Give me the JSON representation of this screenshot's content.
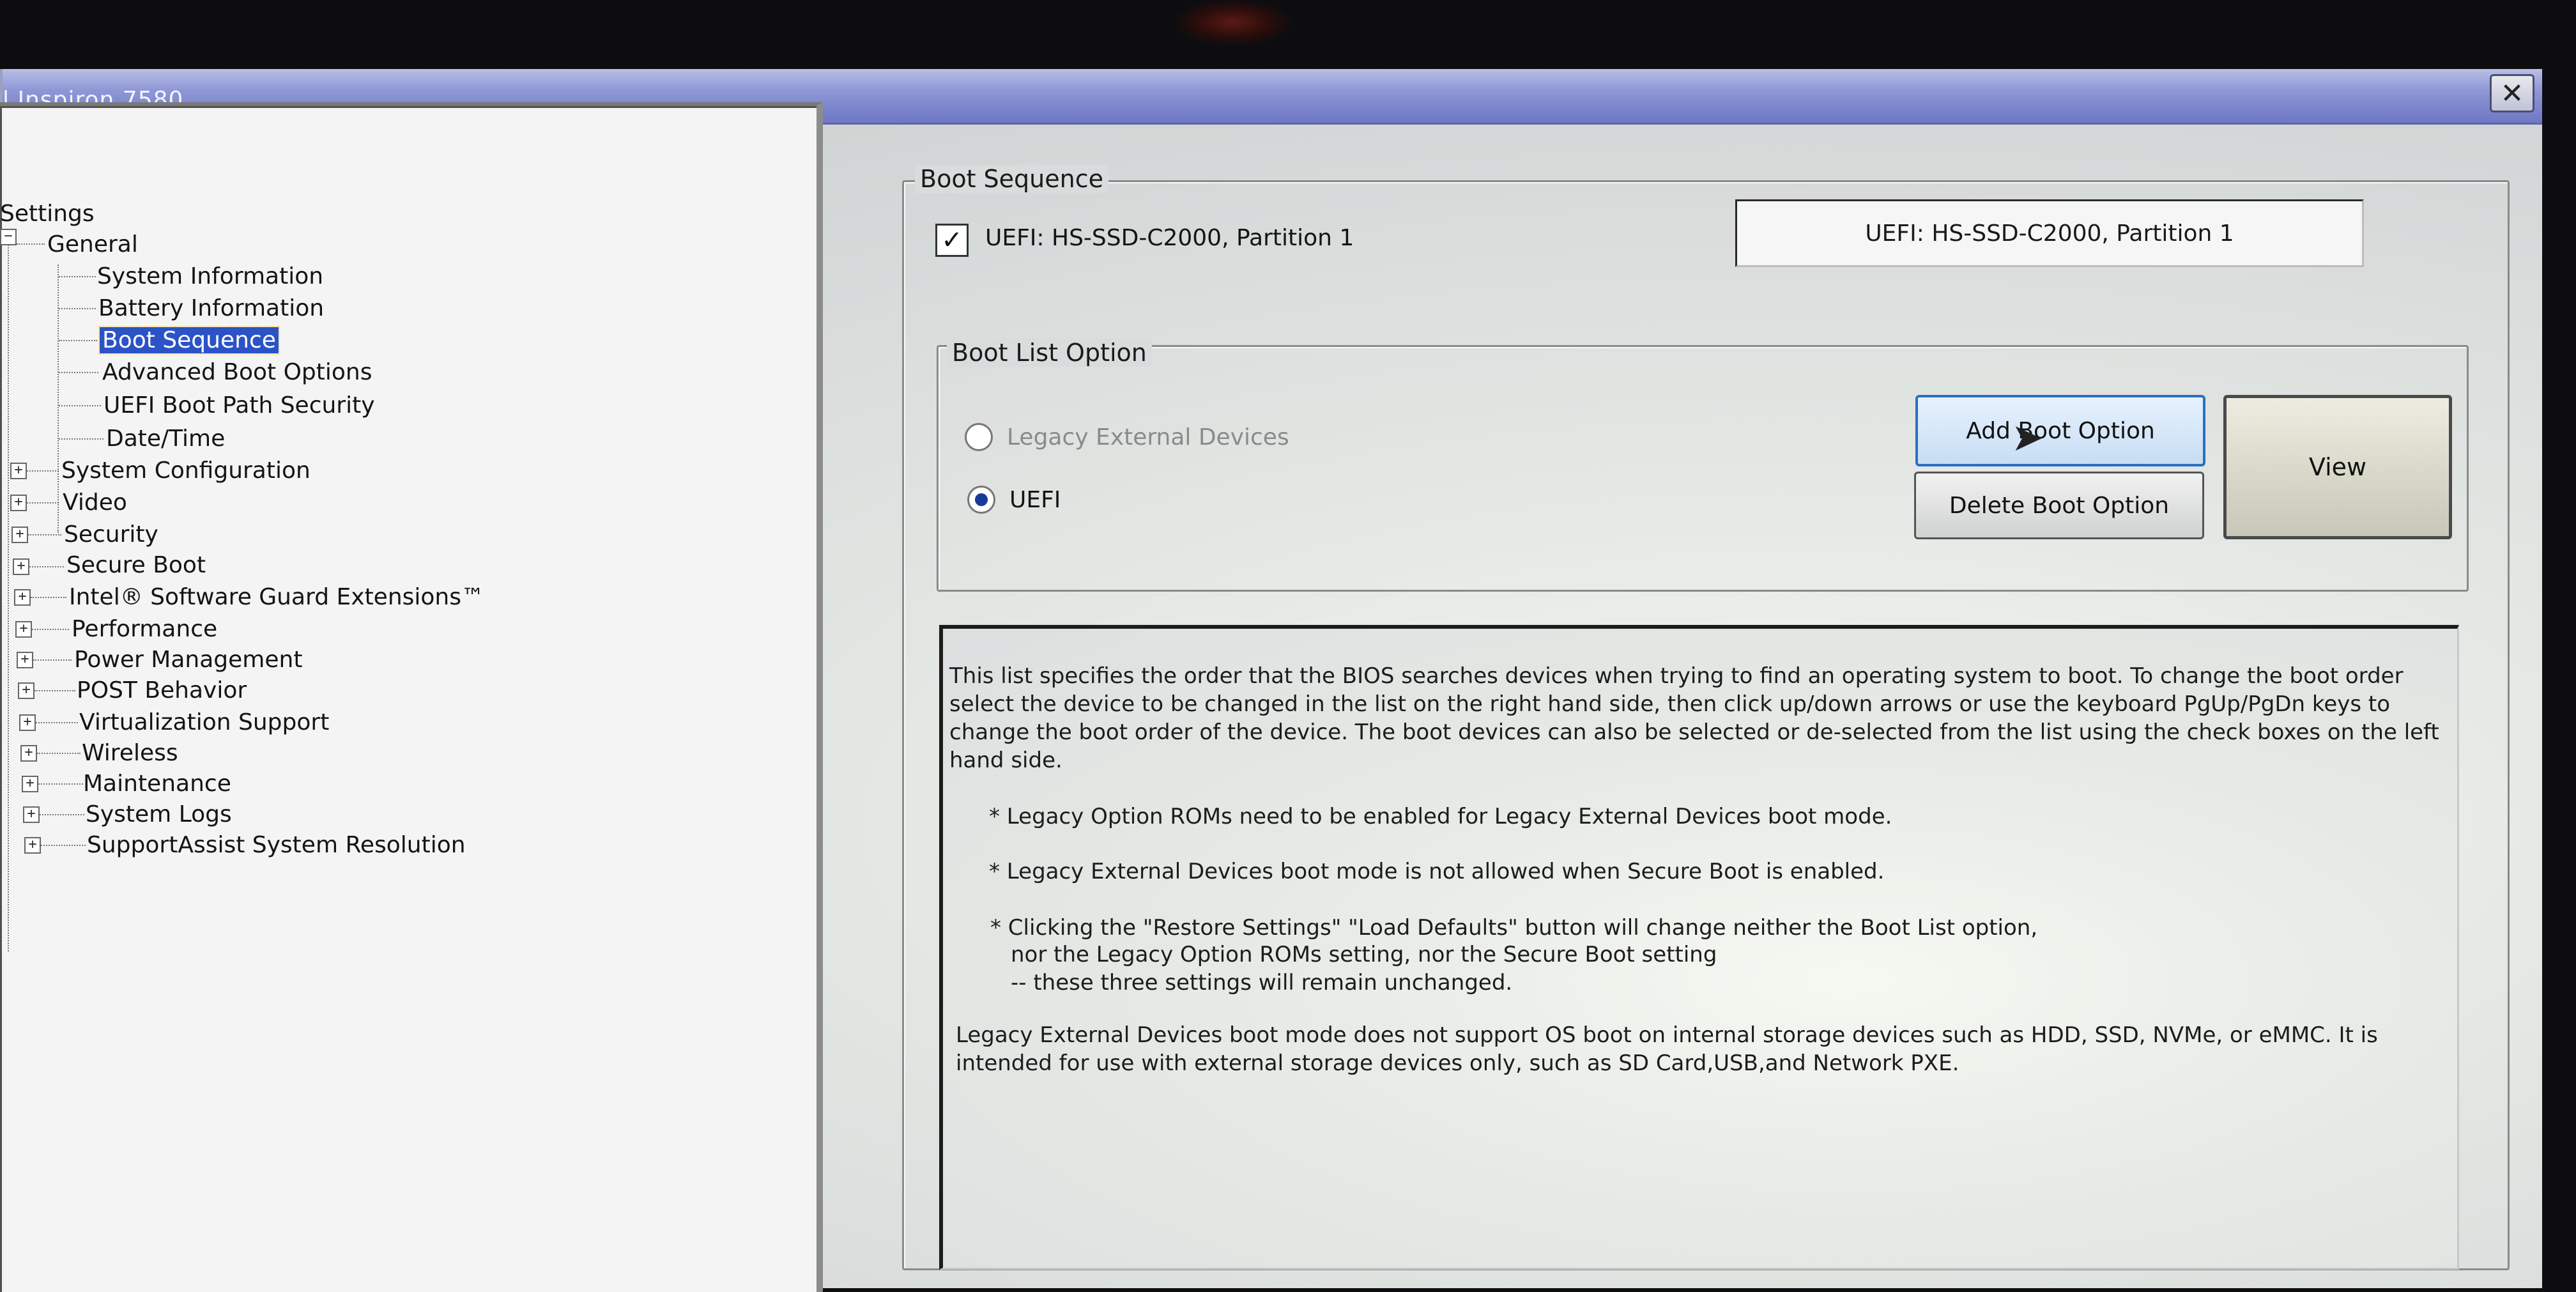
{
  "window": {
    "title": "l Inspiron 7580",
    "close_icon": "close-icon"
  },
  "tree": {
    "root": "Settings",
    "general": "General",
    "general_children": [
      "System Information",
      "Battery Information",
      "Boot Sequence",
      "Advanced Boot Options",
      "UEFI Boot Path Security",
      "Date/Time"
    ],
    "selected": "Boot Sequence",
    "groups": [
      "System Configuration",
      "Video",
      "Security",
      "Secure Boot",
      "Intel® Software Guard Extensions™",
      "Performance",
      "Power Management",
      "POST Behavior",
      "Virtualization Support",
      "Wireless",
      "Maintenance",
      "System Logs",
      "SupportAssist System Resolution"
    ]
  },
  "boot_sequence": {
    "legend": "Boot Sequence",
    "entry_label": "UEFI: HS-SSD-C2000, Partition 1",
    "entry_checked": true,
    "list_item": "UEFI: HS-SSD-C2000, Partition 1"
  },
  "boot_list_option": {
    "legend": "Boot List Option",
    "options": [
      "Legacy External Devices",
      "UEFI"
    ],
    "selected": "UEFI",
    "add_button": "Add Boot Option",
    "delete_button": "Delete Boot Option",
    "view_button": "View"
  },
  "info": {
    "intro": "This list specifies the order that the BIOS searches devices when trying to find an operating system to boot. To change the boot order select the device to be changed in the list on the right hand side, then click up/down arrows or use the keyboard PgUp/PgDn keys to change the boot order of the device. The boot devices can also be selected or de-selected from the list using the check boxes on the left hand side.",
    "note1": "* Legacy Option ROMs need to be enabled for Legacy External Devices boot mode.",
    "note2": "* Legacy External Devices boot mode is not allowed when Secure Boot is enabled.",
    "note3_line1": "* Clicking the \"Restore Settings\" \"Load Defaults\" button will change neither the Boot List option,",
    "note3_line2": "nor the Legacy Option ROMs setting, nor the Secure Boot setting",
    "note3_line3": "-- these three settings will remain unchanged.",
    "legacy_note": "Legacy External Devices boot mode does not support OS boot on internal storage devices such as HDD, SSD, NVMe, or eMMC. It is intended for use with external storage devices only, such as SD Card,USB,and Network PXE."
  },
  "colors": {
    "titlebar": "#8e97d6",
    "selection": "#2b52c6",
    "focus_border": "#2b6fc2"
  }
}
